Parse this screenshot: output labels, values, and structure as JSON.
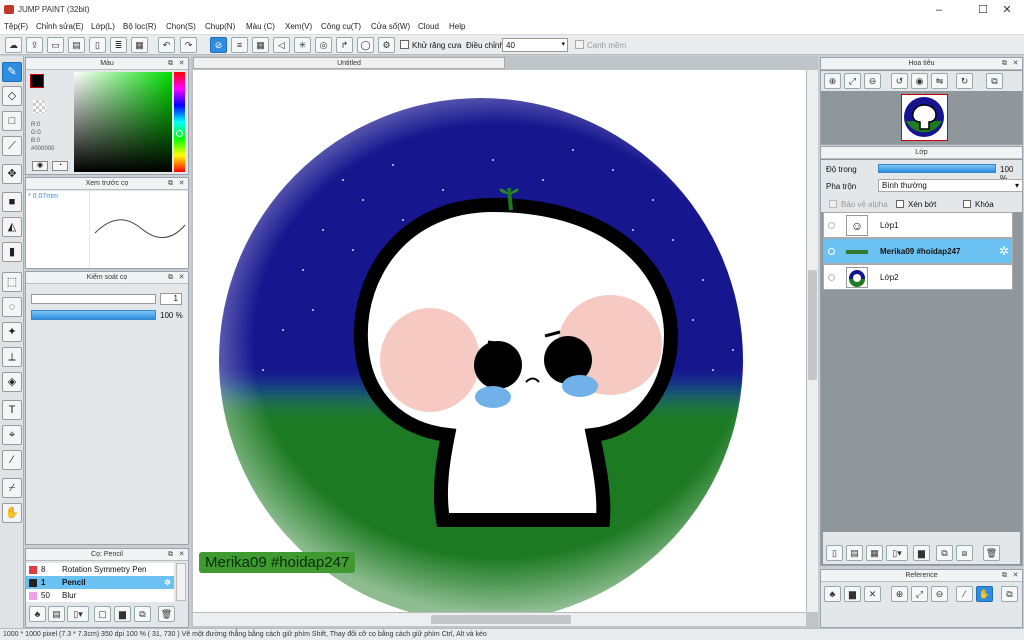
{
  "app": {
    "title": "JUMP PAINT (32bit)"
  },
  "menu": [
    "Tệp(F)",
    "Chỉnh sửa(E)",
    "Lớp(L)",
    "Bộ lọc(R)",
    "Chọn(S)",
    "Chụp(N)",
    "Màu (C)",
    "Xem(V)",
    "Công cụ(T)",
    "Cửa sổ(W)",
    "Cloud",
    "Help"
  ],
  "toolbar": {
    "antialias_label": "Khử răng cưa",
    "adjust_label": "Điều chỉnh",
    "adjust_value": "40",
    "edge_label": "Cạnh mềm"
  },
  "document": {
    "tab_title": "Untitled",
    "watermark": "Merika09 #hoidap247"
  },
  "color_panel": {
    "title": "Màu",
    "r": "R:0",
    "g": "G:0",
    "b": "B:0",
    "hex": "#000000"
  },
  "brush_preview": {
    "title": "Xem trước cọ",
    "size": "* 0.07mm"
  },
  "brush_control": {
    "title": "Kiểm soát cọ",
    "size": "1",
    "opacity": "100 %"
  },
  "brush_list": {
    "title": "Cọ: Pencil",
    "items": [
      {
        "size": "8",
        "name": "Rotation Symmetry Pen",
        "color": "#e23b3b"
      },
      {
        "size": "1",
        "name": "Pencil",
        "color": "#222222"
      },
      {
        "size": "50",
        "name": "Blur",
        "color": "#f0a0e8"
      }
    ]
  },
  "navigator": {
    "title": "Hoa tiêu"
  },
  "layer_panel": {
    "title": "Lớp",
    "opacity_label": "Độ trong",
    "opacity_value": "100 %",
    "blend_label": "Pha trộn",
    "blend_value": "Bình thường",
    "protect_alpha": "Bảo vệ alpha",
    "clip": "Xén bớt",
    "lock": "Khóa",
    "layers": [
      {
        "name": "Lớp1"
      },
      {
        "name": "Merika09 #hoidap247"
      },
      {
        "name": "Lớp2"
      }
    ]
  },
  "reference": {
    "title": "Reference"
  },
  "status": {
    "text": "1000 * 1000 pixel   (7.3 * 7.3cm)   350 dpi   100 %   ( 31, 730 )   Vẽ một đường thẳng bằng cách giữ phím Shift, Thay đổi cỡ cọ bằng cách giữ phím Ctrl, Alt và kéo"
  },
  "colors": {
    "accent": "#2f8de0",
    "sky": "#1a1a8c",
    "grass": "#1f7a22"
  }
}
